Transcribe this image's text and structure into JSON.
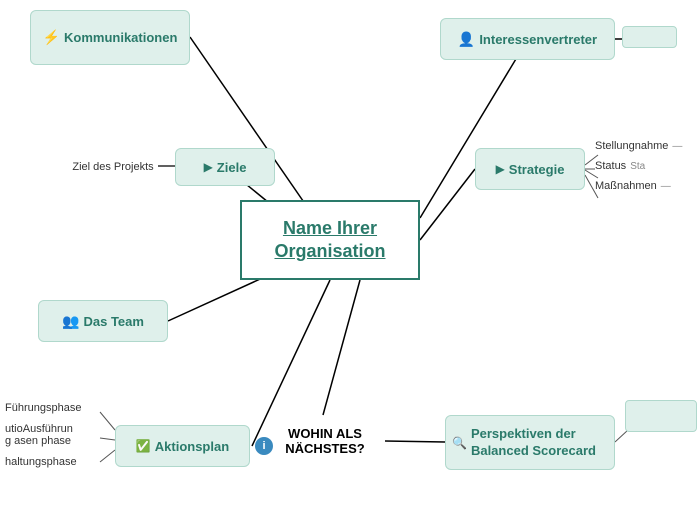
{
  "central": {
    "line1": "Name Ihrer",
    "line2": "Organisation"
  },
  "nodes": {
    "kommunikationen": "Kommunikationen",
    "interessenvertreter": "Interessenvertreter",
    "ziele": "Ziele",
    "ziel_label": "Ziel des Projekts",
    "strategie": "Strategie",
    "stellungnahme": "Stellungnahme",
    "status": "Status",
    "massnahmen": "Maßnahmen",
    "das_team": "Das Team",
    "aktionsplan": "Aktionsplan",
    "wohin": "WOHIN ALS NÄCHSTES?",
    "perspektiven": "Perspektiven der Balanced Scorecard",
    "info": "i",
    "fuhrungsphase": "Führungsphase",
    "ausfuhrungsphase": "utioAusführun\ng asen phase",
    "abschlussphase": "haltungsphase",
    "sta": "Sta",
    "dash": "—"
  },
  "colors": {
    "teal": "#2a7a6a",
    "lightgreen": "#dff0eb",
    "border": "#b0d8cc",
    "blue": "#3a8abf",
    "black": "#000"
  }
}
